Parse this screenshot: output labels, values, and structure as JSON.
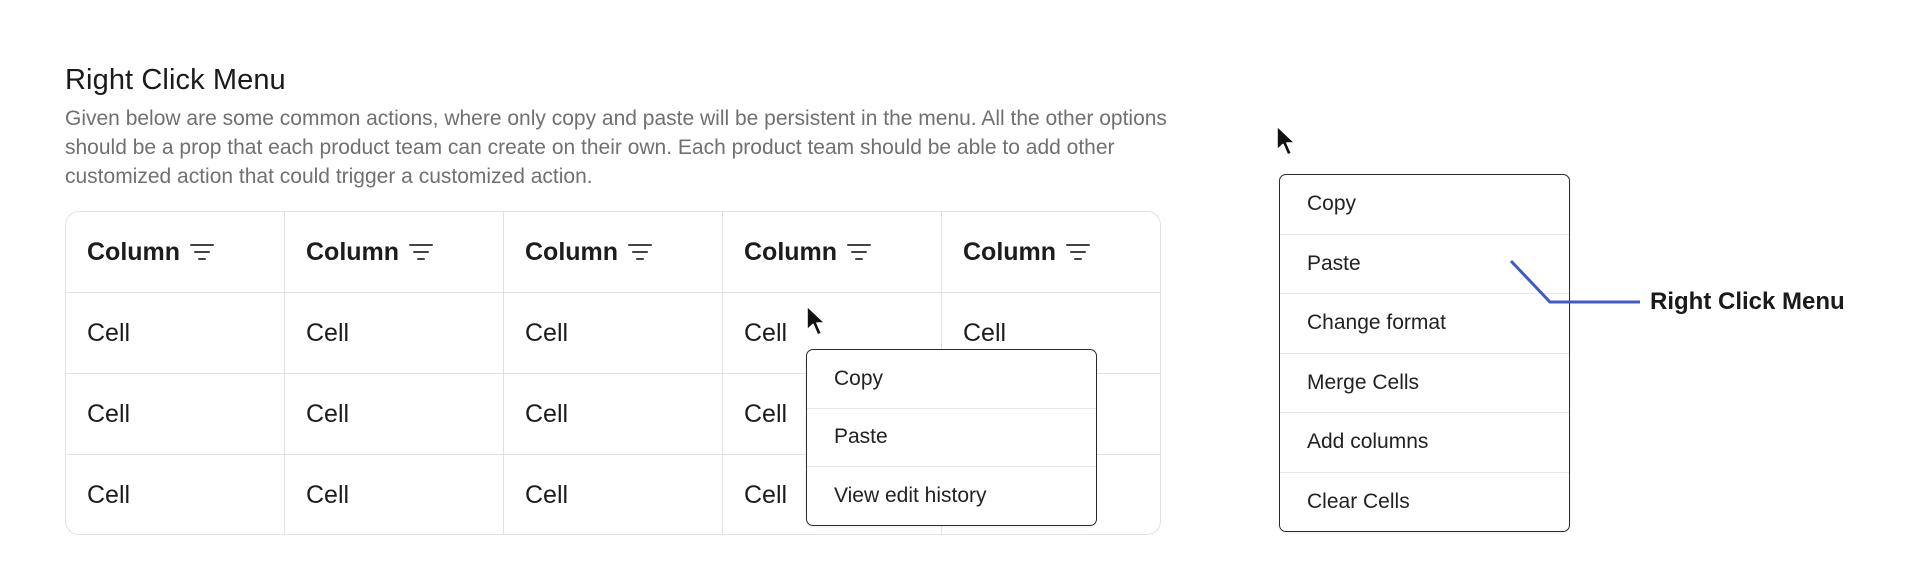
{
  "section": {
    "title": "Right Click Menu",
    "description": "Given below are some common actions, where only copy and paste will be persistent in the menu. All the other options should be a prop that each product team can create on their own. Each product team should be able to add other customized action that could trigger a customized action."
  },
  "table": {
    "headers": [
      "Column",
      "Column",
      "Column",
      "Column",
      "Column"
    ],
    "rows": [
      [
        "Cell",
        "Cell",
        "Cell",
        "Cell",
        "Cell"
      ],
      [
        "Cell",
        "Cell",
        "Cell",
        "Cell",
        ""
      ],
      [
        "Cell",
        "Cell",
        "Cell",
        "Cell",
        ""
      ]
    ]
  },
  "context_menu_small": {
    "items": [
      "Copy",
      "Paste",
      "View edit history"
    ]
  },
  "context_menu_full": {
    "items": [
      "Copy",
      "Paste",
      "Change format",
      "Merge Cells",
      "Add columns",
      "Clear Cells"
    ]
  },
  "callout": {
    "label": "Right Click Menu",
    "color": "#3f5bc4"
  },
  "icons": {
    "filter": "filter-icon",
    "cursor": "mouse-pointer-icon"
  }
}
